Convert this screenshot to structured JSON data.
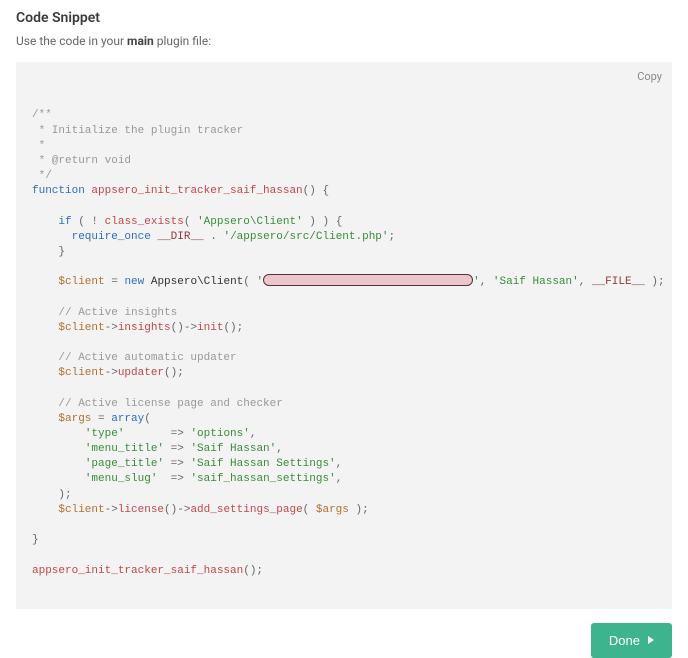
{
  "header": {
    "title": "Code Snippet",
    "instruction_prefix": "Use the code in your ",
    "instruction_bold": "main",
    "instruction_suffix": " plugin file:"
  },
  "copy_label": "Copy",
  "done_label": "Done",
  "code": {
    "comment_open": "/**",
    "comment_line1": " * Initialize the plugin tracker",
    "comment_line2": " *",
    "comment_line3": " * @return void",
    "comment_close": " */",
    "kw_function": "function",
    "func_name": "appsero_init_tracker_saif_hassan",
    "kw_if": "if",
    "kw_not": "!",
    "fn_class_exists": "class_exists",
    "str_client_class": "'Appsero\\Client'",
    "kw_require_once": "require_once",
    "const_dir": "__DIR__",
    "concat_dot": ".",
    "str_client_path": "'/appsero/src/Client.php'",
    "var_client": "$client",
    "kw_new": "new",
    "class_appsero_client": "Appsero\\Client",
    "str_redacted_open": "'",
    "str_redacted_close": "'",
    "str_saif_hassan": "'Saif Hassan'",
    "const_file": "__FILE__",
    "cm_active_insights": "// Active insights",
    "m_insights": "insights",
    "m_init": "init",
    "cm_active_updater": "// Active automatic updater",
    "m_updater": "updater",
    "cm_active_license": "// Active license page and checker",
    "var_args": "$args",
    "kw_array": "array",
    "k_type": "'type'",
    "v_options": "'options'",
    "k_menu_title": "'menu_title'",
    "v_saif_hassan": "'Saif Hassan'",
    "k_page_title": "'page_title'",
    "v_saif_hassan_settings": "'Saif Hassan Settings'",
    "k_menu_slug": "'menu_slug'",
    "v_menu_slug": "'saif_hassan_settings'",
    "m_license": "license",
    "m_add_settings_page": "add_settings_page",
    "fn_call": "appsero_init_tracker_saif_hassan"
  }
}
